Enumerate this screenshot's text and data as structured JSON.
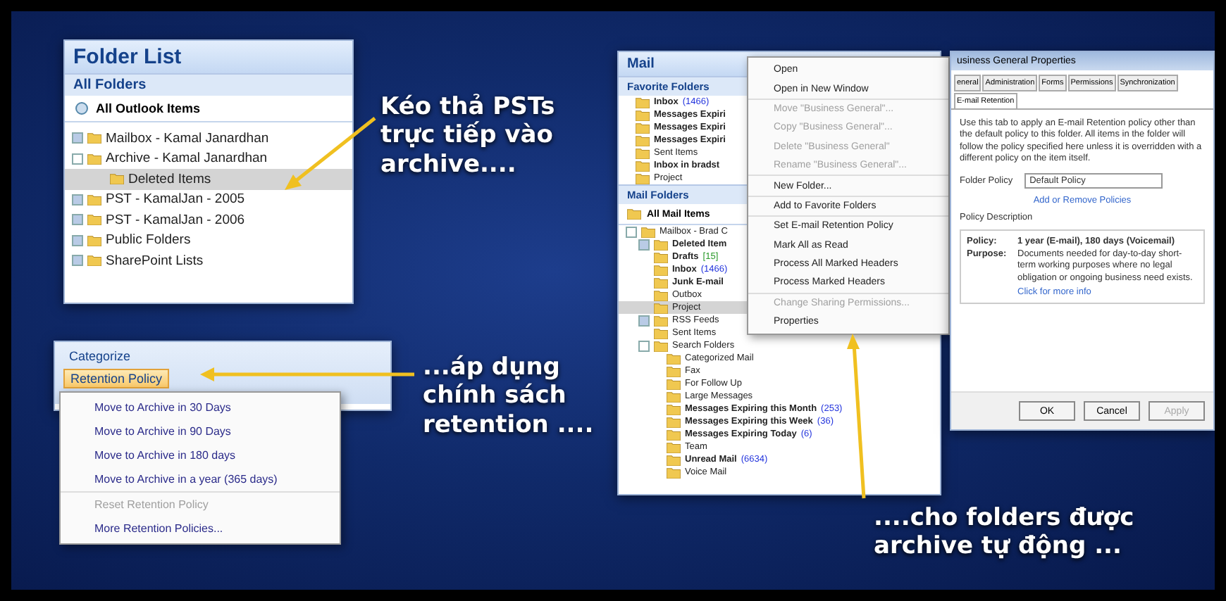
{
  "folder_list": {
    "title": "Folder List",
    "section": "All Folders",
    "scope": "All Outlook Items",
    "tree": [
      {
        "label": "Mailbox - Kamal Janardhan",
        "expanded": false,
        "selected": false
      },
      {
        "label": "Archive - Kamal Janardhan",
        "expanded": true,
        "selected": false,
        "children": [
          {
            "label": "Deleted Items",
            "selected": true
          }
        ]
      },
      {
        "label": "PST - KamalJan - 2005",
        "expanded": false,
        "selected": false
      },
      {
        "label": "PST - KamalJan - 2006",
        "expanded": false,
        "selected": false
      },
      {
        "label": "Public Folders",
        "expanded": false,
        "selected": false
      },
      {
        "label": "SharePoint Lists",
        "expanded": false,
        "selected": false
      }
    ]
  },
  "captions": [
    {
      "text": "Kéo thả PSTs trực tiếp vào archive...."
    },
    {
      "text": "...áp dụng chính sách retention ...."
    },
    {
      "text": "....cho folders được archive tự động ..."
    }
  ],
  "ribbon": {
    "categorize": "Categorize",
    "retention_button": "Retention Policy",
    "menu": [
      {
        "label": "Move to Archive in 30 Days",
        "disabled": false
      },
      {
        "label": "Move to Archive in 90 Days",
        "disabled": false
      },
      {
        "label": "Move to Archive in 180 days",
        "disabled": false
      },
      {
        "label": "Move to Archive in a year (365 days)",
        "disabled": false
      },
      {
        "label": "Reset Retention Policy",
        "disabled": true
      },
      {
        "label": "More Retention Policies...",
        "disabled": false
      }
    ]
  },
  "mail_pane": {
    "title": "Mail",
    "favorites_header": "Favorite Folders",
    "favorites": [
      {
        "label": "Inbox",
        "count": "(1466)",
        "unread": true
      },
      {
        "label": "Messages Expiri",
        "unread": true
      },
      {
        "label": "Messages Expiri",
        "unread": true
      },
      {
        "label": "Messages Expiri",
        "unread": true
      },
      {
        "label": "Sent Items",
        "unread": false
      },
      {
        "label": "Inbox in bradst",
        "unread": true
      },
      {
        "label": "Project",
        "unread": false
      }
    ],
    "folders_header": "Mail Folders",
    "all_items": "All Mail Items",
    "tree": [
      {
        "label": "Mailbox - Brad C",
        "unread": false,
        "expanded": true,
        "selected": false,
        "children": [
          {
            "label": "Deleted Item",
            "unread": true,
            "expanded": false,
            "selected": false
          },
          {
            "label": "Drafts",
            "count": "[15]",
            "unread": true,
            "selected": false
          },
          {
            "label": "Inbox",
            "count": "(1466)",
            "unread": true,
            "selected": false
          },
          {
            "label": "Junk E-mail",
            "unread": true,
            "selected": false
          },
          {
            "label": "Outbox",
            "unread": false,
            "selected": false
          },
          {
            "label": "Project",
            "unread": false,
            "selected": true
          },
          {
            "label": "RSS Feeds",
            "unread": false,
            "expanded": false,
            "selected": false
          },
          {
            "label": "Sent Items",
            "unread": false,
            "selected": false
          },
          {
            "label": "Search Folders",
            "unread": false,
            "expanded": true,
            "selected": false,
            "children": [
              {
                "label": "Categorized Mail",
                "unread": false,
                "selected": false
              },
              {
                "label": "Fax",
                "unread": false,
                "selected": false
              },
              {
                "label": "For Follow Up",
                "unread": false,
                "selected": false
              },
              {
                "label": "Large Messages",
                "unread": false,
                "selected": false
              },
              {
                "label": "Messages Expiring this Month",
                "count": "(253)",
                "unread": true,
                "selected": false
              },
              {
                "label": "Messages Expiring this Week",
                "count": "(36)",
                "unread": true,
                "selected": false
              },
              {
                "label": "Messages Expiring Today",
                "count": "(6)",
                "unread": true,
                "selected": false
              },
              {
                "label": "Team",
                "unread": false,
                "selected": false
              },
              {
                "label": "Unread Mail",
                "count": "(6634)",
                "unread": true,
                "selected": false
              },
              {
                "label": "Voice Mail",
                "unread": false,
                "selected": false
              }
            ]
          }
        ]
      }
    ]
  },
  "context_menu": [
    {
      "label": "Open",
      "disabled": false
    },
    {
      "label": "Open in New Window",
      "disabled": false
    },
    {
      "label": "Move \"Business General\"...",
      "disabled": true
    },
    {
      "label": "Copy \"Business General\"...",
      "disabled": true
    },
    {
      "label": "Delete \"Business General\"",
      "disabled": true
    },
    {
      "label": "Rename \"Business General\"...",
      "disabled": true
    },
    {
      "label": "New Folder...",
      "disabled": false
    },
    {
      "label": "Add to Favorite Folders",
      "disabled": false
    },
    {
      "label": "Set E-mail Retention Policy",
      "disabled": false
    },
    {
      "label": "Mark All as Read",
      "disabled": false
    },
    {
      "label": "Process All Marked Headers",
      "disabled": false
    },
    {
      "label": "Process Marked Headers",
      "disabled": false
    },
    {
      "label": "Change Sharing Permissions...",
      "disabled": true
    },
    {
      "label": "Properties",
      "disabled": false
    }
  ],
  "dialog": {
    "title": "usiness General Properties",
    "tabs": [
      {
        "label": "eneral",
        "selected": false
      },
      {
        "label": "Administration",
        "selected": false
      },
      {
        "label": "Forms",
        "selected": false
      },
      {
        "label": "Permissions",
        "selected": false
      },
      {
        "label": "Synchronization",
        "selected": false
      },
      {
        "label": "E-mail Retention",
        "selected": true
      }
    ],
    "intro": "Use this tab to apply an E-mail Retention policy other than the default policy to this folder. All items in the folder will follow the policy specified here unless it is overridden with a different policy on the item itself.",
    "policy_label": "Folder Policy",
    "policy_value": "Default Policy",
    "add_remove_link": "Add or Remove Policies",
    "description_title": "Policy Description",
    "policy_key": "Policy:",
    "policy_text": "1 year (E-mail), 180 days (Voicemail)",
    "purpose_key": "Purpose:",
    "purpose_text": "Documents needed for day-to-day short-term working purposes where no legal obligation or ongoing business need exists.",
    "more_info_link": "Click for more info",
    "buttons": [
      {
        "label": "OK",
        "disabled": false
      },
      {
        "label": "Cancel",
        "disabled": false
      },
      {
        "label": "Apply",
        "disabled": true
      }
    ]
  }
}
